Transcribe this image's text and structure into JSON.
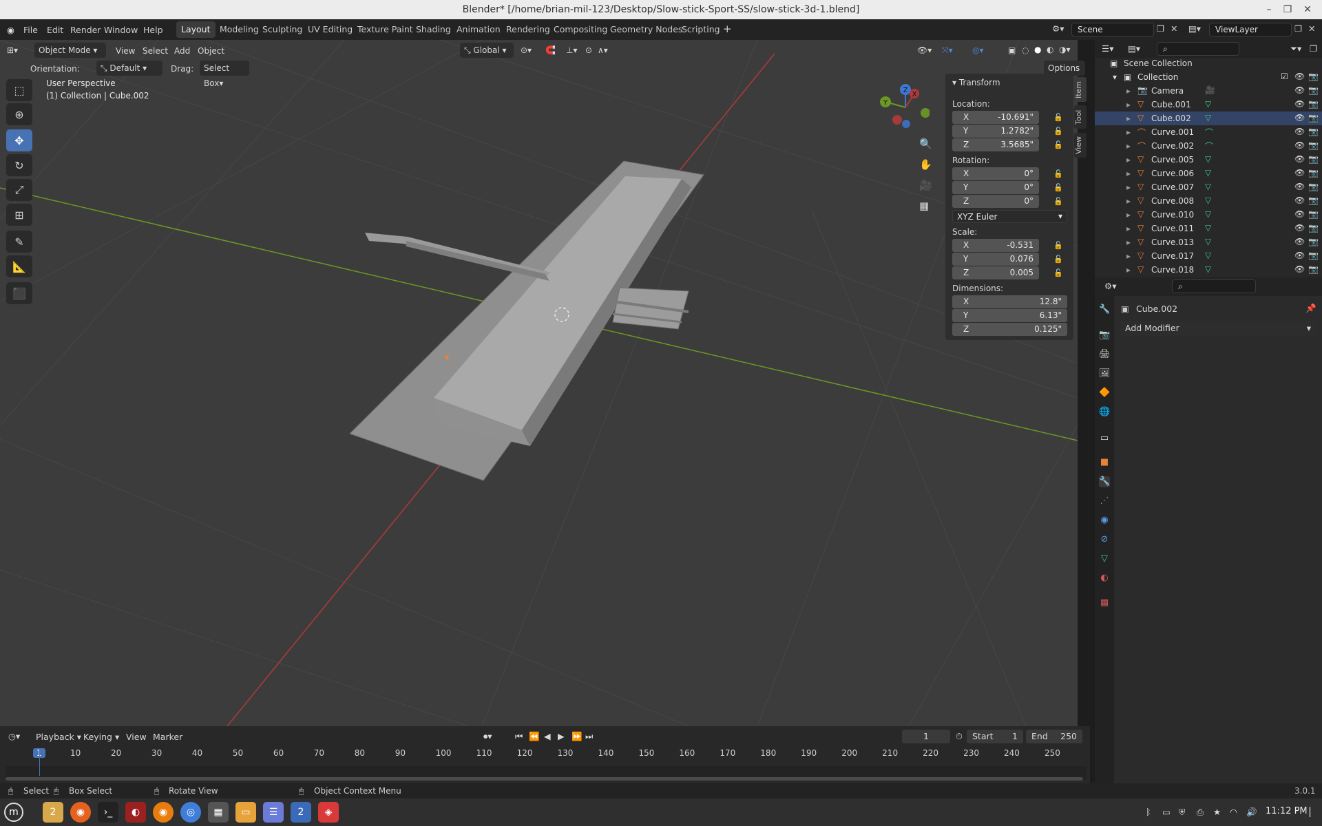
{
  "window": {
    "title": "Blender* [/home/brian-mil-123/Desktop/Slow-stick-Sport-SS/slow-stick-3d-1.blend]"
  },
  "menu": [
    "File",
    "Edit",
    "Render",
    "Window",
    "Help"
  ],
  "workspaces": [
    "Layout",
    "Modeling",
    "Sculpting",
    "UV Editing",
    "Texture Paint",
    "Shading",
    "Animation",
    "Rendering",
    "Compositing",
    "Geometry Nodes",
    "Scripting"
  ],
  "scene": {
    "label": "Scene",
    "view_layer": "ViewLayer"
  },
  "viewport": {
    "mode": "Object Mode",
    "menus": [
      "View",
      "Select",
      "Add",
      "Object"
    ],
    "transform_space": "Global",
    "orientation_label": "Orientation:",
    "orientation_value": "Default",
    "drag_label": "Drag:",
    "drag_value": "Select Box",
    "options": "Options",
    "info_line1": "User Perspective",
    "info_line2": "(1) Collection | Cube.002",
    "gizmo": {
      "x": "X",
      "y": "Y",
      "z": "Z"
    }
  },
  "npanel": {
    "tabs": [
      "Item",
      "Tool",
      "View"
    ],
    "section": "Transform",
    "location_label": "Location:",
    "location": {
      "x": "-10.691\"",
      "y": "1.2782\"",
      "z": "3.5685\""
    },
    "rotation_label": "Rotation:",
    "rotation": {
      "x": "0°",
      "y": "0°",
      "z": "0°"
    },
    "rotation_mode": "XYZ Euler",
    "scale_label": "Scale:",
    "scale": {
      "x": "-0.531",
      "y": "0.076",
      "z": "0.005"
    },
    "dimensions_label": "Dimensions:",
    "dimensions": {
      "x": "12.8\"",
      "y": "6.13\"",
      "z": "0.125\""
    },
    "axes": {
      "x": "X",
      "y": "Y",
      "z": "Z"
    }
  },
  "outliner": {
    "root": "Scene Collection",
    "collection": "Collection",
    "items": [
      "Camera",
      "Cube.001",
      "Cube.002",
      "Curve.001",
      "Curve.002",
      "Curve.005",
      "Curve.006",
      "Curve.007",
      "Curve.008",
      "Curve.010",
      "Curve.011",
      "Curve.013",
      "Curve.017",
      "Curve.018"
    ]
  },
  "properties": {
    "object": "Cube.002",
    "add_modifier": "Add Modifier"
  },
  "timeline": {
    "menus": [
      "Playback",
      "Keying",
      "View",
      "Marker"
    ],
    "current_frame": "1",
    "start_label": "Start",
    "start": "1",
    "end_label": "End",
    "end": "250",
    "ticks": [
      "1",
      "10",
      "20",
      "30",
      "40",
      "50",
      "60",
      "70",
      "80",
      "90",
      "100",
      "110",
      "120",
      "130",
      "140",
      "150",
      "160",
      "170",
      "180",
      "190",
      "200",
      "210",
      "220",
      "230",
      "240",
      "250"
    ]
  },
  "status": {
    "select": "Select",
    "box_select": "Box Select",
    "rotate": "Rotate View",
    "context": "Object Context Menu",
    "version": "3.0.1"
  },
  "taskbar": {
    "time": "11:12 PM",
    "badge_files": "2",
    "badge_cam": "2"
  },
  "colors": {
    "accent": "#4772b3",
    "x_axis": "#b03a3a",
    "y_axis": "#6a9a23",
    "z_axis": "#3c79d6",
    "object_orange": "#e8823a"
  }
}
